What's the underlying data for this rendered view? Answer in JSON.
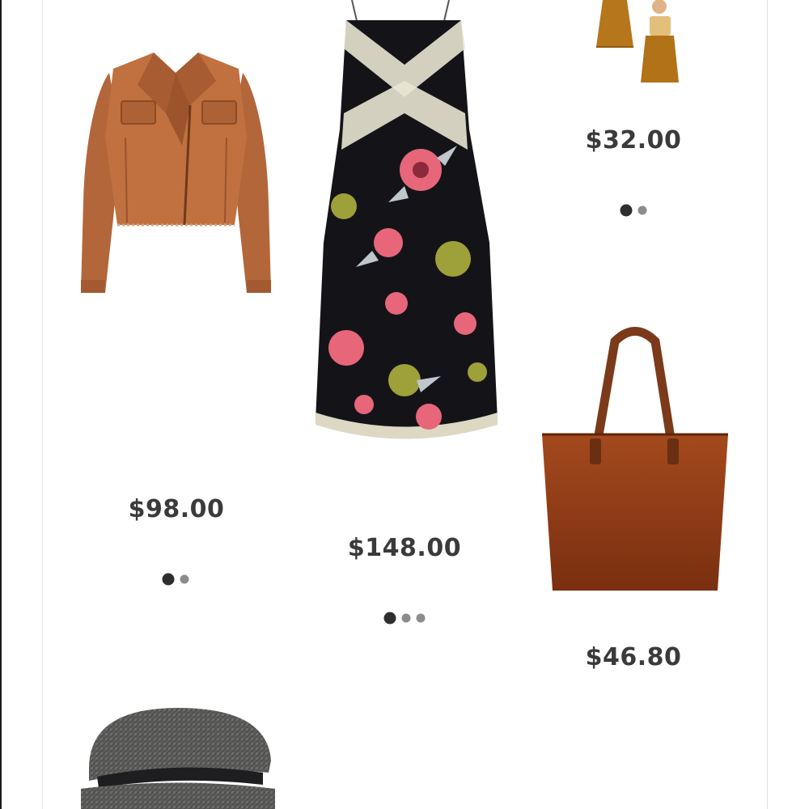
{
  "products": [
    {
      "id": "jacket",
      "price": "$98.00",
      "image_icon": "tan-moto-jacket",
      "color": "#b8693a",
      "dots": [
        true,
        false
      ]
    },
    {
      "id": "dress",
      "price": "$148.00",
      "image_icon": "floral-slip-dress",
      "color": "#1a1a1e",
      "dots": [
        true,
        false,
        false
      ]
    },
    {
      "id": "earrings",
      "price": "$32.00",
      "image_icon": "tassel-earrings",
      "color": "#b07418",
      "dots": [
        true,
        false
      ]
    },
    {
      "id": "tote",
      "price": "$46.80",
      "image_icon": "brown-tote-bag",
      "color": "#8a3a14",
      "dots": []
    },
    {
      "id": "cap",
      "price": "",
      "image_icon": "tweed-baker-boy-cap",
      "color": "#5a5a58",
      "dots": []
    }
  ]
}
